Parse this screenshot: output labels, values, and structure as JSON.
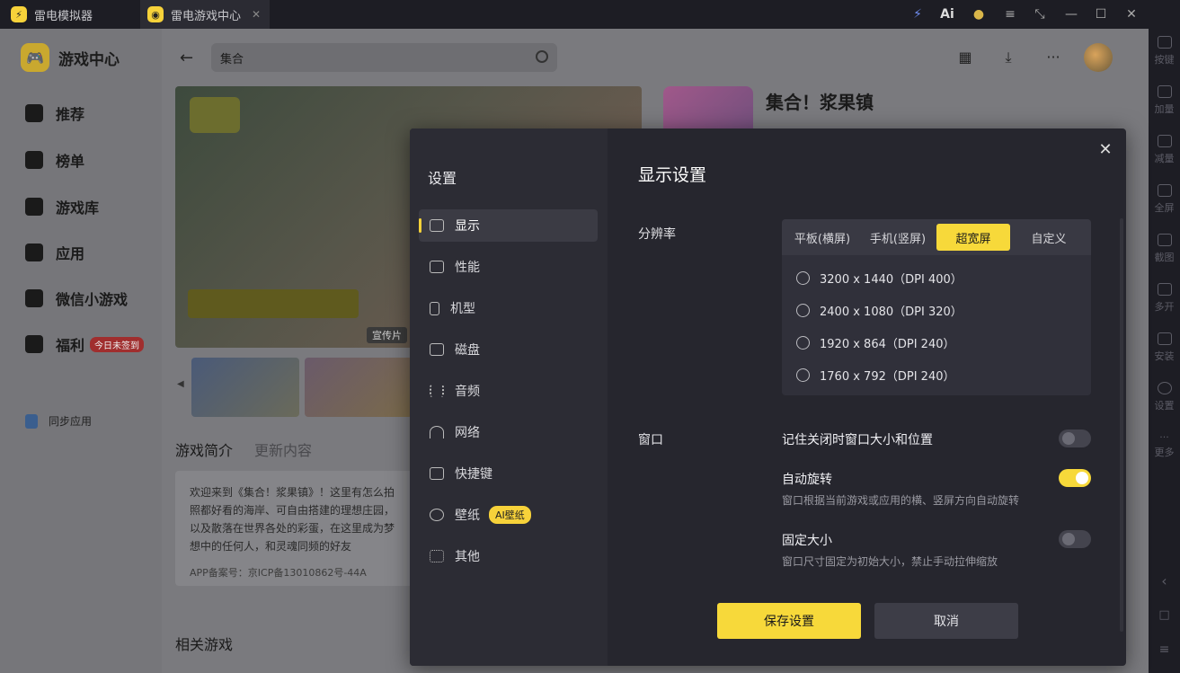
{
  "tabs": [
    {
      "label": "雷电模拟器",
      "icon": "ld-logo-icon"
    },
    {
      "label": "雷电游戏中心",
      "icon": "game-center-logo-icon",
      "active": true
    }
  ],
  "right_toolbar": [
    {
      "label": "按键",
      "icon": "keyboard-icon"
    },
    {
      "label": "加量",
      "icon": "volume-up-icon"
    },
    {
      "label": "减量",
      "icon": "volume-down-icon"
    },
    {
      "label": "全屏",
      "icon": "fullscreen-icon"
    },
    {
      "label": "截图",
      "icon": "scissors-icon"
    },
    {
      "label": "多开",
      "icon": "multi-instance-icon"
    },
    {
      "label": "安装",
      "icon": "apk-install-icon"
    },
    {
      "label": "设置",
      "icon": "gear-icon"
    },
    {
      "label": "更多",
      "icon": "more-icon"
    }
  ],
  "brand": {
    "title": "游戏中心"
  },
  "sidebar": {
    "items": [
      {
        "label": "推荐",
        "icon": "home-icon"
      },
      {
        "label": "榜单",
        "icon": "chart-icon"
      },
      {
        "label": "游戏库",
        "icon": "gamepad-icon"
      },
      {
        "label": "应用",
        "icon": "apps-icon"
      },
      {
        "label": "微信小游戏",
        "icon": "wechat-game-icon"
      },
      {
        "label": "福利",
        "icon": "gift-icon",
        "badge": "今日未签到"
      }
    ],
    "sync": "同步应用"
  },
  "search": {
    "value": "集合"
  },
  "hero": {
    "promo_label": "宣传片"
  },
  "game": {
    "title": "集合！浆果镇"
  },
  "desc_tabs": {
    "intro": "游戏简介",
    "updates": "更新内容"
  },
  "desc": {
    "text": "欢迎来到《集合！浆果镇》！这里有怎么拍照都好看的海岸、可自由搭建的理想庄园，以及散落在世界各处的彩蛋，在这里成为梦想中的任何人，和灵魂同频的好友",
    "icp": "APP备案号：京ICP备13010862号-44A"
  },
  "related": "相关游戏",
  "settings": {
    "title": "设置",
    "menu": [
      {
        "label": "显示",
        "icon": "monitor-icon",
        "active": true
      },
      {
        "label": "性能",
        "icon": "performance-icon"
      },
      {
        "label": "机型",
        "icon": "phone-icon"
      },
      {
        "label": "磁盘",
        "icon": "disk-icon"
      },
      {
        "label": "音频",
        "icon": "audio-icon"
      },
      {
        "label": "网络",
        "icon": "wifi-icon"
      },
      {
        "label": "快捷键",
        "icon": "keyboard-icon"
      },
      {
        "label": "壁纸",
        "icon": "palette-icon",
        "badge": "AI壁纸"
      },
      {
        "label": "其他",
        "icon": "grid-icon"
      }
    ],
    "display": {
      "title": "显示设置",
      "resolution_label": "分辨率",
      "res_tabs": [
        "平板(横屏)",
        "手机(竖屏)",
        "超宽屏",
        "自定义"
      ],
      "res_active": "超宽屏",
      "res_options": [
        "3200 x 1440（DPI 400）",
        "2400 x 1080（DPI 320）",
        "1920 x 864（DPI 240）",
        "1760 x 792（DPI 240）"
      ],
      "window_label": "窗口",
      "window_options": [
        {
          "title": "记住关闭时窗口大小和位置",
          "desc": "",
          "on": false
        },
        {
          "title": "自动旋转",
          "desc": "窗口根据当前游戏或应用的横、竖屏方向自动旋转",
          "on": true
        },
        {
          "title": "固定大小",
          "desc": "窗口尺寸固定为初始大小，禁止手动拉伸缩放",
          "on": false
        }
      ]
    },
    "save_label": "保存设置",
    "cancel_label": "取消"
  },
  "colors": {
    "accent": "#f7d93a",
    "modal_bg": "#26262e",
    "sidebar_bg": "#2c2c34"
  }
}
